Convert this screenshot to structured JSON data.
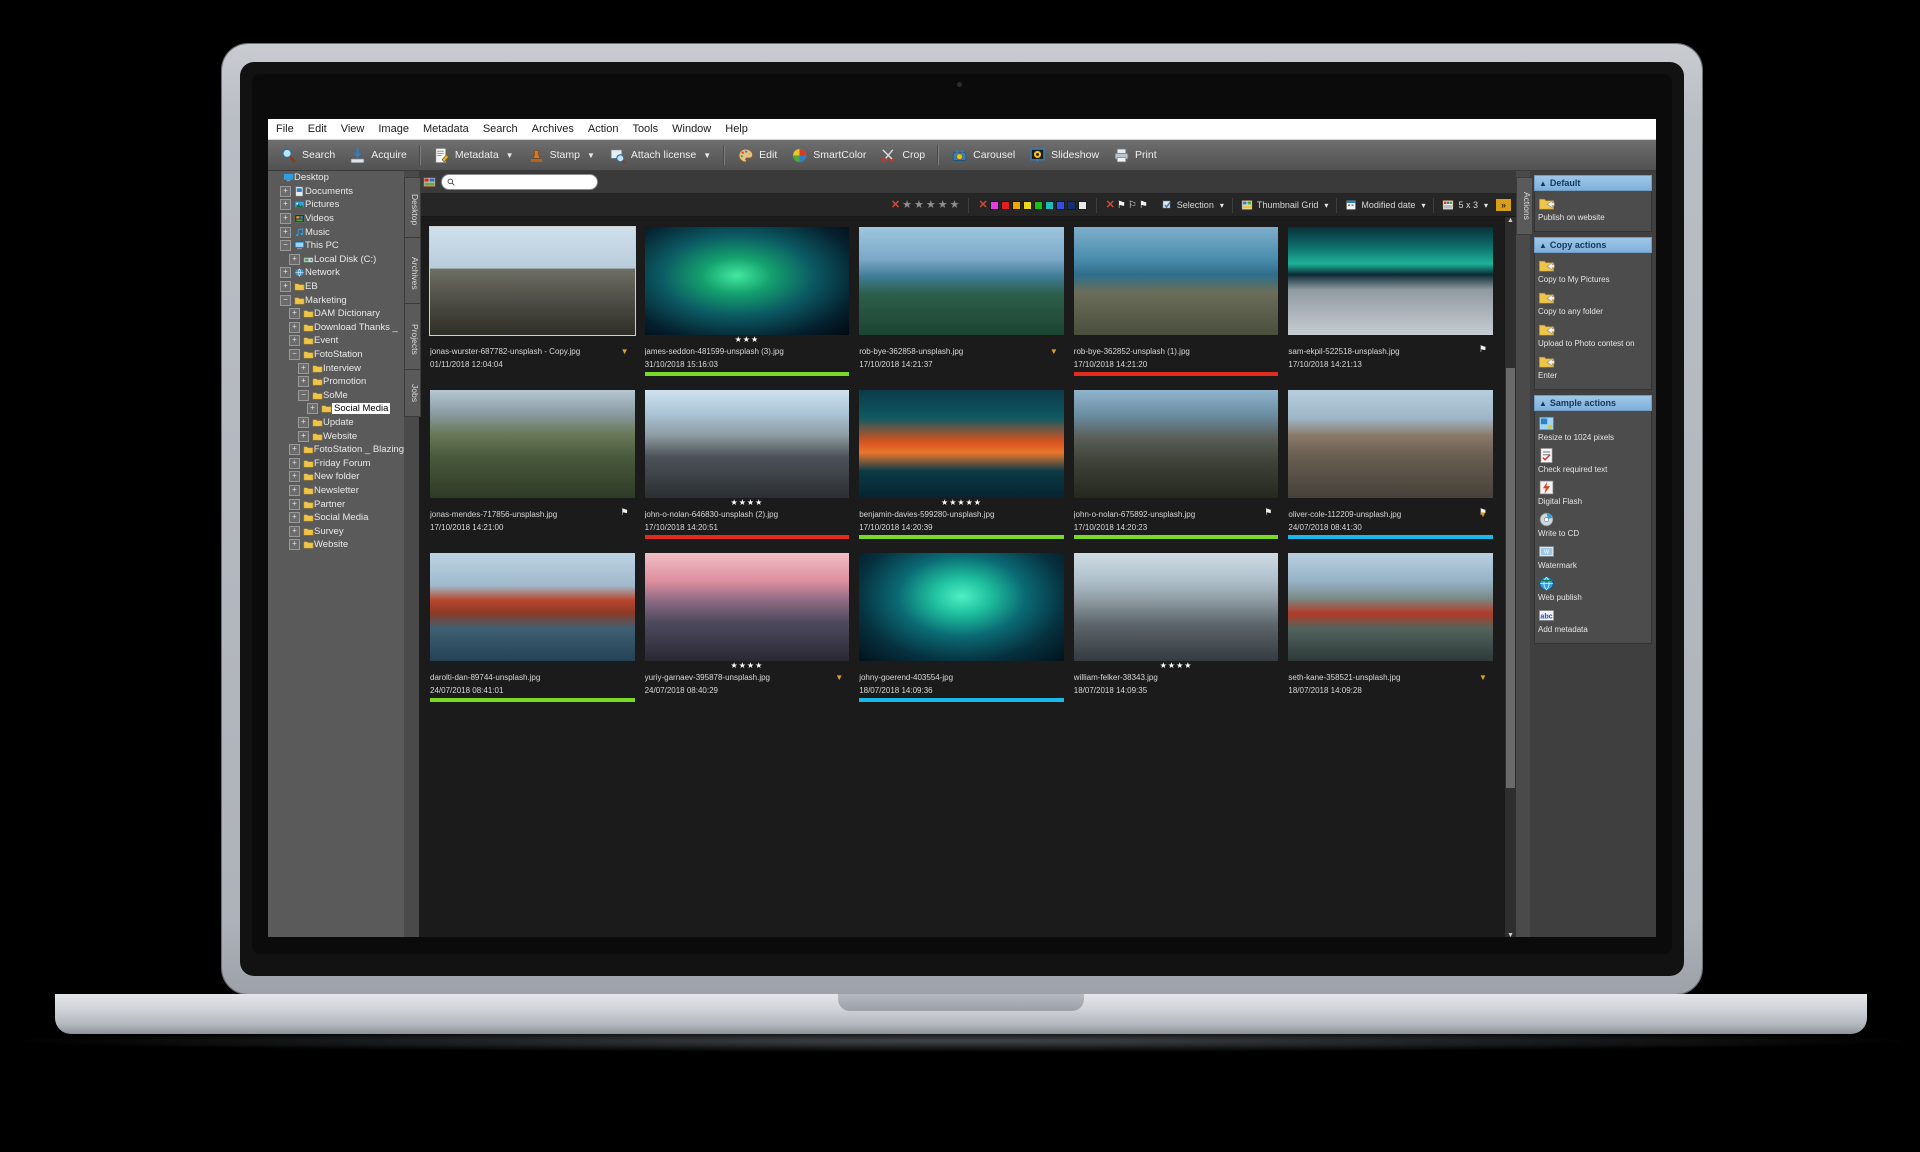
{
  "app": {
    "menu": [
      "File",
      "Edit",
      "View",
      "Image",
      "Metadata",
      "Search",
      "Archives",
      "Action",
      "Tools",
      "Window",
      "Help"
    ],
    "toolbar": [
      {
        "label": "Search",
        "icon": "magnifier-icon",
        "caret": false
      },
      {
        "label": "Acquire",
        "icon": "acquire-icon",
        "caret": false
      },
      {
        "sep": true
      },
      {
        "label": "Metadata",
        "icon": "metadata-icon",
        "caret": true
      },
      {
        "label": "Stamp",
        "icon": "stamp-icon",
        "caret": true
      },
      {
        "label": "Attach license",
        "icon": "license-icon",
        "caret": true
      },
      {
        "sep": true
      },
      {
        "label": "Edit",
        "icon": "palette-icon",
        "caret": false
      },
      {
        "label": "SmartColor",
        "icon": "smartcolor-icon",
        "caret": false
      },
      {
        "label": "Crop",
        "icon": "crop-icon",
        "caret": false
      },
      {
        "sep": true
      },
      {
        "label": "Carousel",
        "icon": "carousel-icon",
        "caret": false
      },
      {
        "label": "Slideshow",
        "icon": "slideshow-icon",
        "caret": false
      },
      {
        "label": "Print",
        "icon": "print-icon",
        "caret": false
      }
    ]
  },
  "tree": {
    "rail_tabs": [
      "Desktop",
      "Archives",
      "Projects",
      "Jobs"
    ],
    "items": [
      {
        "label": "Desktop",
        "depth": 0,
        "exp": "none",
        "icon": "desktop-icon",
        "sel": false
      },
      {
        "label": "Documents",
        "depth": 1,
        "exp": "plus",
        "icon": "documents-icon",
        "sel": false
      },
      {
        "label": "Pictures",
        "depth": 1,
        "exp": "plus",
        "icon": "pictures-icon",
        "sel": false
      },
      {
        "label": "Videos",
        "depth": 1,
        "exp": "plus",
        "icon": "videos-icon",
        "sel": false
      },
      {
        "label": "Music",
        "depth": 1,
        "exp": "plus",
        "icon": "music-icon",
        "sel": false
      },
      {
        "label": "This PC",
        "depth": 1,
        "exp": "minus",
        "icon": "pc-icon",
        "sel": false
      },
      {
        "label": "Local Disk (C:)",
        "depth": 2,
        "exp": "plus",
        "icon": "disk-icon",
        "sel": false
      },
      {
        "label": "Network",
        "depth": 1,
        "exp": "plus",
        "icon": "network-icon",
        "sel": false
      },
      {
        "label": "EB",
        "depth": 1,
        "exp": "plus",
        "icon": "folder-icon",
        "sel": false
      },
      {
        "label": "Marketing",
        "depth": 1,
        "exp": "minus",
        "icon": "folder-icon",
        "sel": false
      },
      {
        "label": "DAM Dictionary",
        "depth": 2,
        "exp": "plus",
        "icon": "folder-icon",
        "sel": false
      },
      {
        "label": "Download Thanks _",
        "depth": 2,
        "exp": "plus",
        "icon": "folder-icon",
        "sel": false
      },
      {
        "label": "Event",
        "depth": 2,
        "exp": "plus",
        "icon": "folder-icon",
        "sel": false
      },
      {
        "label": "FotoStation",
        "depth": 2,
        "exp": "minus",
        "icon": "folder-icon",
        "sel": false
      },
      {
        "label": "Interview",
        "depth": 3,
        "exp": "plus",
        "icon": "folder-icon",
        "sel": false
      },
      {
        "label": "Promotion",
        "depth": 3,
        "exp": "plus",
        "icon": "folder-icon",
        "sel": false
      },
      {
        "label": "SoMe",
        "depth": 3,
        "exp": "minus",
        "icon": "folder-icon",
        "sel": false
      },
      {
        "label": "Social Media",
        "depth": 4,
        "exp": "plus",
        "icon": "folder-icon",
        "sel": true
      },
      {
        "label": "Update",
        "depth": 3,
        "exp": "plus",
        "icon": "folder-icon",
        "sel": false
      },
      {
        "label": "Website",
        "depth": 3,
        "exp": "plus",
        "icon": "folder-icon",
        "sel": false
      },
      {
        "label": "FotoStation _ Blazing",
        "depth": 2,
        "exp": "plus",
        "icon": "folder-icon",
        "sel": false
      },
      {
        "label": "Friday Forum",
        "depth": 2,
        "exp": "plus",
        "icon": "folder-icon",
        "sel": false
      },
      {
        "label": "New folder",
        "depth": 2,
        "exp": "plus",
        "icon": "folder-icon",
        "sel": false
      },
      {
        "label": "Newsletter",
        "depth": 2,
        "exp": "plus",
        "icon": "folder-icon",
        "sel": false
      },
      {
        "label": "Partner",
        "depth": 2,
        "exp": "plus",
        "icon": "folder-icon",
        "sel": false
      },
      {
        "label": "Social Media",
        "depth": 2,
        "exp": "plus",
        "icon": "folder-icon",
        "sel": false
      },
      {
        "label": "Survey",
        "depth": 2,
        "exp": "plus",
        "icon": "folder-icon",
        "sel": false
      },
      {
        "label": "Website",
        "depth": 2,
        "exp": "plus",
        "icon": "folder-icon",
        "sel": false
      }
    ]
  },
  "search": {
    "placeholder": "",
    "value": ""
  },
  "filters": {
    "stars": 5,
    "colors": [
      "#e13de1",
      "#e02020",
      "#f0a800",
      "#e8d820",
      "#18c018",
      "#18c0b8",
      "#3050e0",
      "#16306a",
      "#e8e8e8"
    ],
    "flags": 3,
    "selection_label": "Selection",
    "view_label": "Thumbnail Grid",
    "sort_label": "Modified date",
    "layout_label": "5 x 3",
    "next_label": "»"
  },
  "thumbs": [
    {
      "file": "jonas-wurster-687782-unsplash - Copy.jpg",
      "date": "01/11/2018 12:04:04",
      "rating": 0,
      "bar": "",
      "selected": true,
      "flag": "",
      "dmark": true,
      "art": "cliff"
    },
    {
      "file": "james-seddon-481599-unsplash (3).jpg",
      "date": "31/10/2018 15:16:03",
      "rating": 3,
      "bar": "#79d929",
      "selected": false,
      "flag": "",
      "dmark": false,
      "art": "aurora1"
    },
    {
      "file": "rob-bye-362858-unsplash.jpg",
      "date": "17/10/2018 14:21:37",
      "rating": 0,
      "bar": "",
      "selected": false,
      "flag": "",
      "dmark": true,
      "art": "fjord1"
    },
    {
      "file": "rob-bye-362852-unsplash (1).jpg",
      "date": "17/10/2018 14:21:20",
      "rating": 0,
      "bar": "#e02b1d",
      "selected": false,
      "flag": "",
      "dmark": false,
      "art": "fjord2"
    },
    {
      "file": "sam-ekpil-522518-unsplash.jpg",
      "date": "17/10/2018 14:21:13",
      "rating": 0,
      "bar": "",
      "selected": false,
      "flag": "white",
      "dmark": false,
      "art": "dogs"
    },
    {
      "file": "jonas-mendes-717856-unsplash.jpg",
      "date": "17/10/2018 14:21:00",
      "rating": 0,
      "bar": "",
      "selected": false,
      "flag": "white",
      "dmark": false,
      "art": "valley"
    },
    {
      "file": "john-o-nolan-646830-unsplash (2).jpg",
      "date": "17/10/2018 14:20:51",
      "rating": 4,
      "bar": "#e02b1d",
      "selected": false,
      "flag": "",
      "dmark": false,
      "art": "road"
    },
    {
      "file": "benjamin-davies-599280-unsplash.jpg",
      "date": "17/10/2018 14:20:39",
      "rating": 5,
      "bar": "#79d929",
      "selected": false,
      "flag": "",
      "dmark": false,
      "art": "kayak"
    },
    {
      "file": "john-o-nolan-675892-unsplash.jpg",
      "date": "17/10/2018 14:20:23",
      "rating": 0,
      "bar": "#79d929",
      "selected": false,
      "flag": "white",
      "dmark": false,
      "art": "lofoten"
    },
    {
      "file": "oliver-cole-112209-unsplash.jpg",
      "date": "24/07/2018 08:41:30",
      "rating": 0,
      "bar": "#18b8e8",
      "selected": false,
      "flag": "white",
      "dmark": true,
      "art": "city"
    },
    {
      "file": "darolti-dan-89744-unsplash.jpg",
      "date": "24/07/2018 08:41:01",
      "rating": 0,
      "bar": "#79d929",
      "selected": false,
      "flag": "",
      "dmark": false,
      "art": "harbour"
    },
    {
      "file": "yuriy-garnaev-395878-unsplash.jpg",
      "date": "24/07/2018 08:40:29",
      "rating": 4,
      "bar": "",
      "selected": false,
      "flag": "",
      "dmark": true,
      "art": "pink"
    },
    {
      "file": "johny-goerend-403554-jpg",
      "date": "18/07/2018 14:09:36",
      "rating": 0,
      "bar": "#18b8e8",
      "selected": false,
      "flag": "",
      "dmark": false,
      "art": "aurora2"
    },
    {
      "file": "william-felker-38343.jpg",
      "date": "18/07/2018 14:09:35",
      "rating": 4,
      "bar": "",
      "selected": false,
      "flag": "",
      "dmark": false,
      "art": "glacier"
    },
    {
      "file": "seth-kane-358521-unsplash.jpg",
      "date": "18/07/2018 14:09:28",
      "rating": 0,
      "bar": "",
      "selected": false,
      "flag": "",
      "dmark": true,
      "art": "redhouse"
    }
  ],
  "actions": {
    "rail_label": "Actions",
    "groups": [
      {
        "title": "Default",
        "items": [
          {
            "label": "Publish on website",
            "icon": "folder-action-icon"
          }
        ]
      },
      {
        "title": "Copy actions",
        "items": [
          {
            "label": "Copy to My Pictures",
            "icon": "folder-action-icon"
          },
          {
            "label": "Copy to any folder",
            "icon": "folder-action-icon"
          },
          {
            "label": "Upload to Photo contest on",
            "icon": "folder-action-icon"
          },
          {
            "label": "Enter",
            "icon": "folder-action-icon"
          }
        ]
      },
      {
        "title": "Sample actions",
        "items": [
          {
            "label": "Resize to 1024 pixels",
            "icon": "resize-icon"
          },
          {
            "label": "Check required text",
            "icon": "checklist-icon"
          },
          {
            "label": "Digital Flash",
            "icon": "flash-icon"
          },
          {
            "label": "Write to CD",
            "icon": "cd-icon"
          },
          {
            "label": "Watermark",
            "icon": "watermark-icon"
          },
          {
            "label": "Web publish",
            "icon": "globe-icon"
          },
          {
            "label": "Add metadata",
            "icon": "abc-icon"
          }
        ]
      }
    ]
  }
}
